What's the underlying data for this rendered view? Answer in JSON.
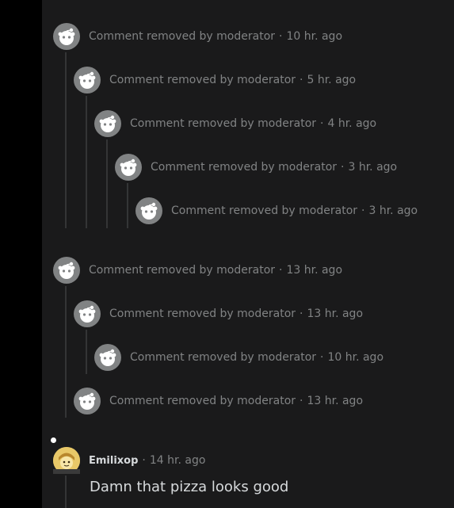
{
  "removed_comments": [
    {
      "text": "Comment removed by moderator",
      "time": "10 hr. ago"
    },
    {
      "text": "Comment removed by moderator",
      "time": "5 hr. ago"
    },
    {
      "text": "Comment removed by moderator",
      "time": "4 hr. ago"
    },
    {
      "text": "Comment removed by moderator",
      "time": "3 hr. ago"
    },
    {
      "text": "Comment removed by moderator",
      "time": "3 hr. ago"
    },
    {
      "text": "Comment removed by moderator",
      "time": "13 hr. ago"
    },
    {
      "text": "Comment removed by moderator",
      "time": "13 hr. ago"
    },
    {
      "text": "Comment removed by moderator",
      "time": "10 hr. ago"
    },
    {
      "text": "Comment removed by moderator",
      "time": "13 hr. ago"
    }
  ],
  "separator": "·",
  "user_comment": {
    "author": "Emilixop",
    "time": "14 hr. ago",
    "body": "Damn that pizza looks good"
  },
  "colors": {
    "background": "#1a1a1b",
    "meta_text": "#818384",
    "body_text": "#d7dadc",
    "thread_line": "#343536"
  }
}
